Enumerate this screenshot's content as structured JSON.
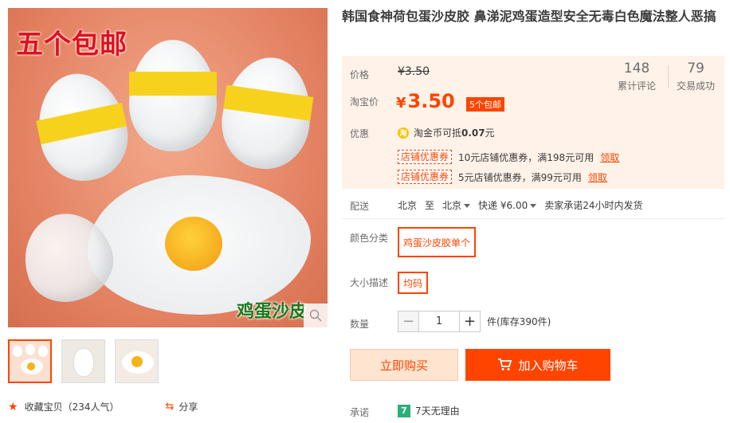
{
  "main_image": {
    "overlay_text": "五个包邮",
    "bottom_text": "鸡蛋沙皮"
  },
  "title": "韩国食神荷包蛋沙皮胶 鼻涕泥鸡蛋造型安全无毒白色魔法整人恶搞",
  "price": {
    "label": "价格",
    "original": "¥3.50",
    "taobao_label": "淘宝价",
    "currency": "¥",
    "value": "3.50",
    "tag": "5个包邮",
    "reviews_count": "148",
    "reviews_label": "累计评论",
    "sales_count": "79",
    "sales_label": "交易成功"
  },
  "promo": {
    "label": "优惠",
    "coin_icon_text": "淘",
    "coin_text": "淘金币可抵",
    "coin_value": "0.07",
    "coin_unit": "元",
    "coupons": [
      {
        "tag": "店铺优惠券",
        "text": "10元店铺优惠券，满198元可用",
        "link": "领取"
      },
      {
        "tag": "店铺优惠券",
        "text": "5元店铺优惠券，满99元可用",
        "link": "领取"
      }
    ]
  },
  "delivery": {
    "label": "配送",
    "from": "北京",
    "to_word": "至",
    "to": "北京",
    "shipping": "快递 ¥6.00",
    "promise": "卖家承诺24小时内发货"
  },
  "color": {
    "label": "颜色分类",
    "option": "鸡蛋沙皮胶单个"
  },
  "size": {
    "label": "大小描述",
    "option": "均码"
  },
  "quantity": {
    "label": "数量",
    "value": "1",
    "minus": "−",
    "plus": "+",
    "stock": "件(库存390件)"
  },
  "actions": {
    "buy": "立即购买",
    "cart": "加入购物车"
  },
  "promise": {
    "label": "承诺",
    "icon_text": "7",
    "text": "7天无理由"
  },
  "footer": {
    "favorite": "收藏宝贝（234人气）",
    "share": "分享"
  },
  "colors": {
    "accent": "#ff4400",
    "price_bg": "#fff2e8",
    "promise_green": "#2ab07a"
  }
}
